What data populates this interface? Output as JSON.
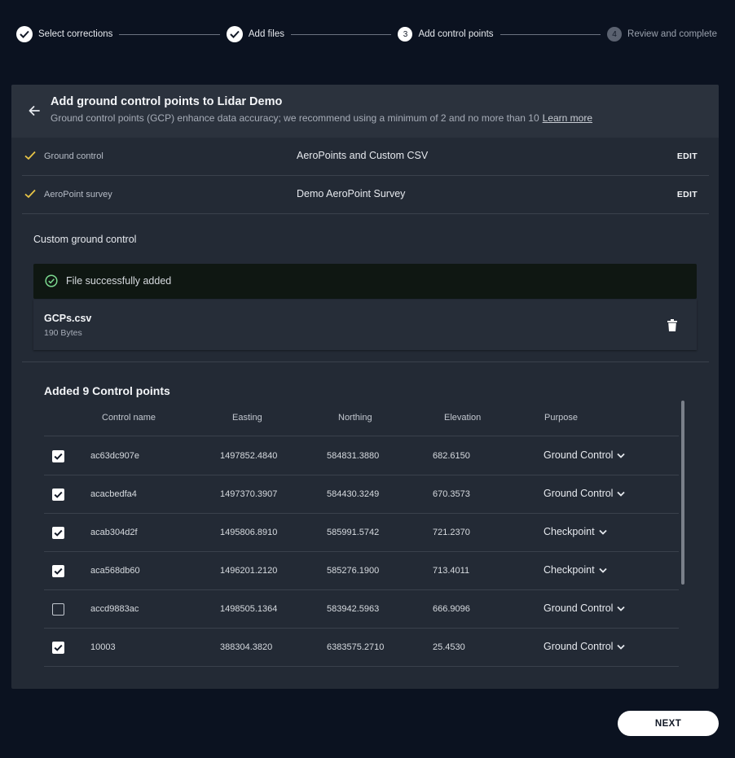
{
  "stepper": {
    "steps": [
      {
        "label": "Select corrections",
        "state": "done",
        "number": ""
      },
      {
        "label": "Add files",
        "state": "done",
        "number": ""
      },
      {
        "label": "Add control points",
        "state": "current",
        "number": "3"
      },
      {
        "label": "Review and complete",
        "state": "todo",
        "number": "4"
      }
    ]
  },
  "card": {
    "title": "Add ground control points to Lidar Demo",
    "subtitle": "Ground control points (GCP) enhance data accuracy; we recommend using a minimum of 2 and no more than 10",
    "learn_more": "Learn more"
  },
  "summary": [
    {
      "label": "Ground control",
      "value": "AeroPoints and Custom CSV",
      "edit": "EDIT"
    },
    {
      "label": "AeroPoint survey",
      "value": "Demo AeroPoint Survey",
      "edit": "EDIT"
    }
  ],
  "custom_gc": {
    "title": "Custom ground control",
    "success_message": "File successfully added",
    "file_name": "GCPs.csv",
    "file_size": "190 Bytes"
  },
  "points": {
    "title": "Added 9 Control points",
    "columns": [
      "Control name",
      "Easting",
      "Northing",
      "Elevation",
      "Purpose"
    ],
    "rows": [
      {
        "checked": true,
        "name": "ac63dc907e",
        "easting": "1497852.4840",
        "northing": "584831.3880",
        "elevation": "682.6150",
        "purpose": "Ground Control"
      },
      {
        "checked": true,
        "name": "acacbedfa4",
        "easting": "1497370.3907",
        "northing": "584430.3249",
        "elevation": "670.3573",
        "purpose": "Ground Control"
      },
      {
        "checked": true,
        "name": "acab304d2f",
        "easting": "1495806.8910",
        "northing": "585991.5742",
        "elevation": "721.2370",
        "purpose": "Checkpoint"
      },
      {
        "checked": true,
        "name": "aca568db60",
        "easting": "1496201.2120",
        "northing": "585276.1900",
        "elevation": "713.4011",
        "purpose": "Checkpoint"
      },
      {
        "checked": false,
        "name": "accd9883ac",
        "easting": "1498505.1364",
        "northing": "583942.5963",
        "elevation": "666.9096",
        "purpose": "Ground Control"
      },
      {
        "checked": true,
        "name": "10003",
        "easting": "388304.3820",
        "northing": "6383575.2710",
        "elevation": "25.4530",
        "purpose": "Ground Control"
      }
    ]
  },
  "footer": {
    "next_label": "NEXT"
  },
  "colors": {
    "accent_check": "#e8c547",
    "success": "#7bd88f",
    "background": "#0b1220",
    "card": "#232a35"
  }
}
